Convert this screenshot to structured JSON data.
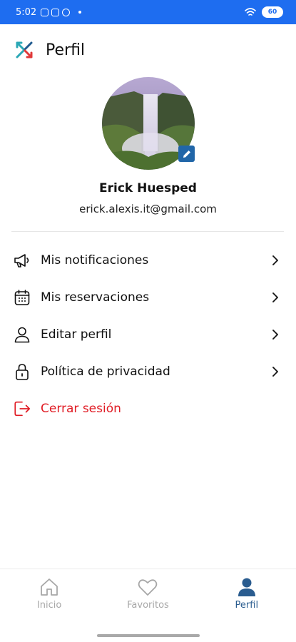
{
  "status_bar": {
    "time": "5:02",
    "battery": "60"
  },
  "header": {
    "title": "Perfil",
    "logo": "app-logo-icon"
  },
  "profile": {
    "name": "Erick Huesped",
    "email": "erick.alexis.it@gmail.com"
  },
  "menu": [
    {
      "label": "Mis notificaciones",
      "icon": "megaphone-icon"
    },
    {
      "label": "Mis reservaciones",
      "icon": "calendar-icon"
    },
    {
      "label": "Editar perfil",
      "icon": "user-icon"
    },
    {
      "label": "Política de privacidad",
      "icon": "lock-icon"
    }
  ],
  "logout": {
    "label": "Cerrar sesión",
    "icon": "logout-icon"
  },
  "bottom_nav": [
    {
      "label": "Inicio",
      "icon": "home-icon",
      "active": false
    },
    {
      "label": "Favoritos",
      "icon": "heart-icon",
      "active": false
    },
    {
      "label": "Perfil",
      "icon": "person-icon",
      "active": true
    }
  ],
  "colors": {
    "status_bar": "#1e6df0",
    "accent": "#2a5c8f",
    "logout": "#e01b24",
    "inactive": "#a7a7a7"
  }
}
